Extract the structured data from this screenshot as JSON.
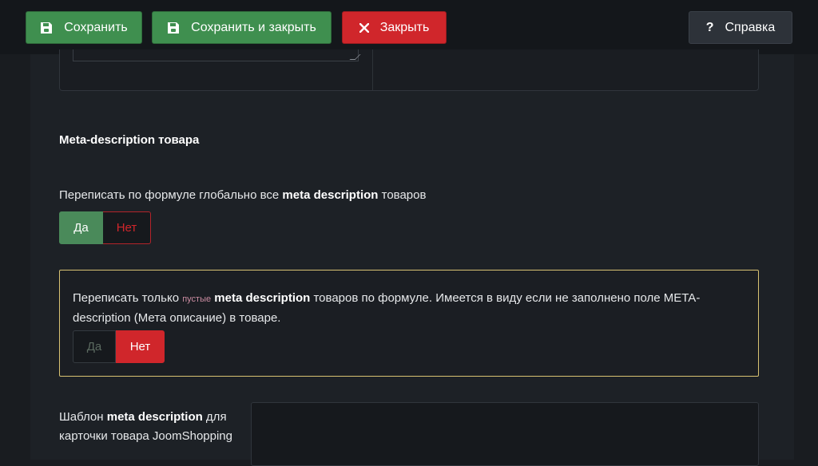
{
  "toolbar": {
    "save_label": "Сохранить",
    "save_close_label": "Сохранить и закрыть",
    "close_label": "Закрыть",
    "help_label": "Справка"
  },
  "icons": {
    "save": "floppy-disk-icon",
    "close": "x-icon",
    "help": "question-mark-icon"
  },
  "colors": {
    "green": "#3f8f4f",
    "red": "#d0262b",
    "warning_border": "#d9c372"
  },
  "section": {
    "title": "Meta-description товара"
  },
  "global_rewrite": {
    "label_before": "Переписать по формуле глобально все ",
    "label_bold": "meta description",
    "label_after": " товаров",
    "yes": "Да",
    "no": "Нет",
    "selected": "Да"
  },
  "empty_only": {
    "text_before": "Переписать только ",
    "text_small": "пустые",
    "text_bold": "meta description",
    "text_after": " товаров по формуле. Имеется в виду если не заполнено поле META-description (Мета описание) в товаре.",
    "yes": "Да",
    "no": "Нет",
    "selected": "Нет"
  },
  "template": {
    "label_before": "Шаблон ",
    "label_bold": "meta description",
    "label_after": " для карточки товара JoomShopping",
    "value": ""
  }
}
